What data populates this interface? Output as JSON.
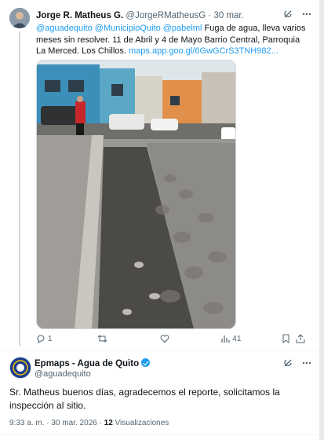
{
  "tweet": {
    "author_name": "Jorge R. Matheus G.",
    "author_handle": "@JorgeRMatheusG",
    "separator": "·",
    "time": "30 mar.",
    "mentions": "@aguadequito @MunicipioQuito @pabelml",
    "text": " Fuga de agua, lleva varios meses sin resolver. 11 de Abril y 4 de Mayo Barrio Central, Parroquia La Merced. Los Chillos. ",
    "link": "maps.app.goo.gl/6GwGCrS3TNH982...",
    "reply_count": "1",
    "retweet_count": "",
    "like_count": "",
    "view_count": "41"
  },
  "reply": {
    "author_name": "Epmaps - Agua de Quito",
    "author_handle": "@aguadequito",
    "text": "Sr. Matheus buenos días, agradecemos el reporte, solicitamos la inspección al sitio.",
    "time": "9:33 a. m.",
    "separator": "·",
    "date": "30 mar. 2026",
    "separator2": "·",
    "views": "12",
    "views_label": "Visualizaciones"
  },
  "colors": {
    "link": "#1d9bf0",
    "muted": "#536471",
    "text": "#0f1419"
  }
}
